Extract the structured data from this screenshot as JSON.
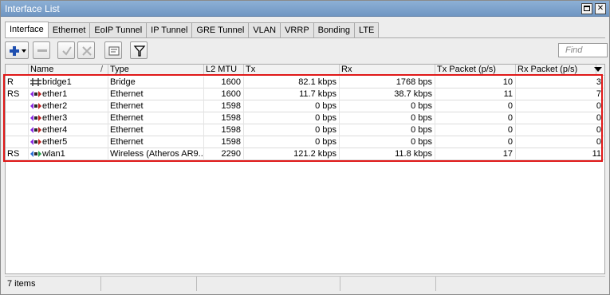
{
  "window": {
    "title": "Interface List"
  },
  "tabs": [
    "Interface",
    "Ethernet",
    "EoIP Tunnel",
    "IP Tunnel",
    "GRE Tunnel",
    "VLAN",
    "VRRP",
    "Bonding",
    "LTE"
  ],
  "toolbar": {
    "add_icon": "plus-icon",
    "remove_icon": "minus-icon",
    "enable_icon": "check-icon",
    "disable_icon": "x-icon",
    "comment_icon": "comment-icon",
    "filter_icon": "filter-icon",
    "find_placeholder": "Find"
  },
  "columns": [
    "",
    "Name",
    "Type",
    "L2 MTU",
    "Tx",
    "Rx",
    "Tx Packet (p/s)",
    "Rx Packet (p/s)"
  ],
  "rows": [
    {
      "flags": "R",
      "icon": "bridge-icon",
      "name": "bridge1",
      "type": "Bridge",
      "l2mtu": "1600",
      "tx": "82.1 kbps",
      "rx": "1768 bps",
      "txp": "10",
      "rxp": "3"
    },
    {
      "flags": "RS",
      "icon": "ethernet-icon",
      "name": "ether1",
      "type": "Ethernet",
      "l2mtu": "1600",
      "tx": "11.7 kbps",
      "rx": "38.7 kbps",
      "txp": "11",
      "rxp": "7"
    },
    {
      "flags": "",
      "icon": "ethernet-icon",
      "name": "ether2",
      "type": "Ethernet",
      "l2mtu": "1598",
      "tx": "0 bps",
      "rx": "0 bps",
      "txp": "0",
      "rxp": "0"
    },
    {
      "flags": "",
      "icon": "ethernet-icon",
      "name": "ether3",
      "type": "Ethernet",
      "l2mtu": "1598",
      "tx": "0 bps",
      "rx": "0 bps",
      "txp": "0",
      "rxp": "0"
    },
    {
      "flags": "",
      "icon": "ethernet-icon",
      "name": "ether4",
      "type": "Ethernet",
      "l2mtu": "1598",
      "tx": "0 bps",
      "rx": "0 bps",
      "txp": "0",
      "rxp": "0"
    },
    {
      "flags": "",
      "icon": "ethernet-icon",
      "name": "ether5",
      "type": "Ethernet",
      "l2mtu": "1598",
      "tx": "0 bps",
      "rx": "0 bps",
      "txp": "0",
      "rxp": "0"
    },
    {
      "flags": "RS",
      "icon": "wireless-icon",
      "name": "wlan1",
      "type": "Wireless (Atheros AR9...",
      "l2mtu": "2290",
      "tx": "121.2 kbps",
      "rx": "11.8 kbps",
      "txp": "17",
      "rxp": "11"
    }
  ],
  "status": {
    "items": "7 items"
  },
  "colors": {
    "highlight": "#e01818",
    "titlebar": "#7aa0cc",
    "add_icon": "#1f4fb0"
  }
}
